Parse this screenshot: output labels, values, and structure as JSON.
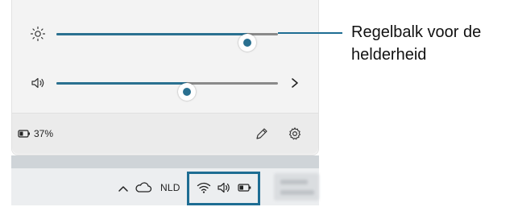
{
  "quick_settings": {
    "brightness": {
      "icon": "sun-icon",
      "level": 0.86
    },
    "volume": {
      "icon": "speaker-icon",
      "level": 0.59,
      "more_icon": "chevron-right-icon"
    },
    "battery": {
      "icon": "battery-icon",
      "percent_text": "37%"
    },
    "edit_icon": "pencil-icon",
    "settings_icon": "gear-icon"
  },
  "taskbar": {
    "overflow_icon": "chevron-up-icon",
    "cloud_icon": "onedrive-cloud-icon",
    "language": "NLD",
    "system_icons": [
      "wifi-icon",
      "speaker-icon",
      "battery-icon"
    ]
  },
  "callout": {
    "line1": "Regelbalk voor de",
    "line2": "helderheid"
  },
  "colors": {
    "accent": "#2a7090",
    "callout_blue": "#1e6d93",
    "panel_bg": "#f3f3f3",
    "footer_bg": "#ebebeb"
  }
}
